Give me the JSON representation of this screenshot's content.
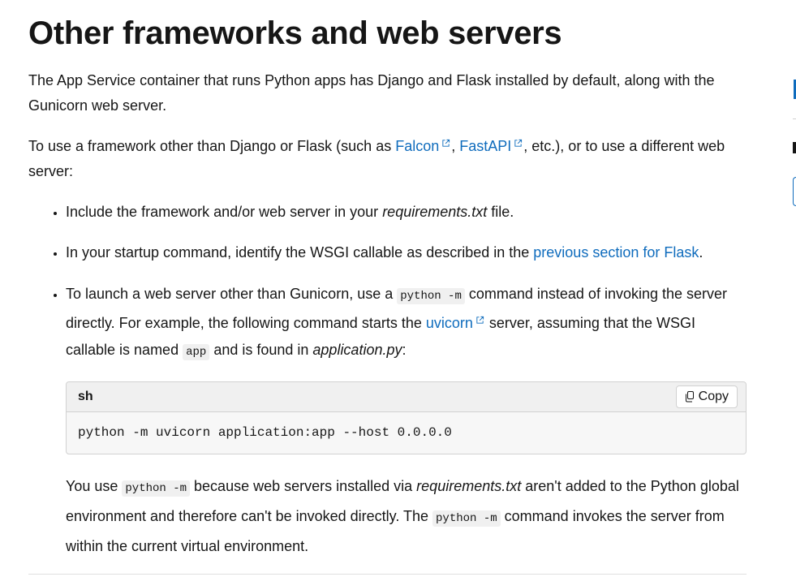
{
  "article": {
    "title": "Other frameworks and web servers",
    "intro": "The App Service container that runs Python apps has Django and Flask installed by default, along with the Gunicorn web server.",
    "para2": {
      "before": "To use a framework other than Django or Flask (such as ",
      "link1": "Falcon",
      "sep": ", ",
      "link2": "FastAPI",
      "after": ", etc.), or to use a different web server:"
    },
    "bullets": {
      "b1": {
        "before": "Include the framework and/or web server in your ",
        "em": "requirements.txt",
        "after": " file."
      },
      "b2": {
        "before": "In your startup command, identify the WSGI callable as described in the ",
        "link": "previous section for Flask",
        "after": "."
      },
      "b3": {
        "t1": "To launch a web server other than Gunicorn, use a ",
        "code1": "python -m",
        "t2": " command instead of invoking the server directly. For example, the following command starts the ",
        "link": "uvicorn",
        "t3": " server, assuming that the WSGI callable is named ",
        "code2": "app",
        "t4": " and is found in ",
        "em": "application.py",
        "t5": ":"
      }
    },
    "codeblock": {
      "language": "sh",
      "copy_label": "Copy",
      "code": "python -m uvicorn application:app --host 0.0.0.0"
    },
    "after_para": {
      "t1": "You use ",
      "code1": "python -m",
      "t2": " because web servers installed via ",
      "em": "requirements.txt",
      "t3": " aren't added to the Python global environment and therefore can't be invoked directly. The ",
      "code2": "python -m",
      "t4": " command invokes the server from within the current virtual environment."
    }
  },
  "colors": {
    "link": "#0f6cbd",
    "text": "#161616",
    "code_bg": "#f0f0f0"
  },
  "icons": {
    "external": "external-link-icon",
    "copy": "copy-icon"
  }
}
